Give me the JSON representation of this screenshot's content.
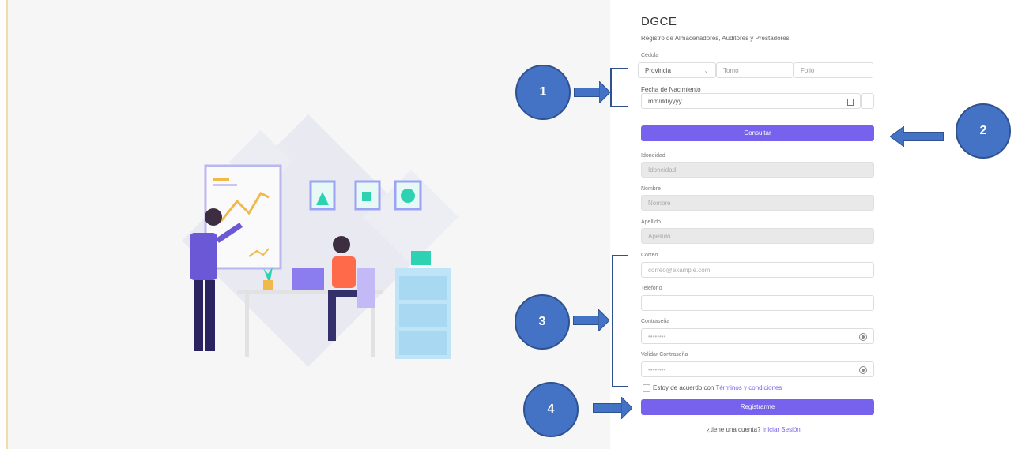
{
  "header": {
    "title": "DGCE",
    "subtitle": "Registro de Almacenadores, Auditores y Prestadores"
  },
  "cedula": {
    "label": "Cédula",
    "provincia": "Provincia",
    "tomo": "Tomo",
    "folio": "Folio"
  },
  "birth": {
    "label": "Fecha de Nacimiento",
    "placeholder": "mm/dd/yyyy"
  },
  "consult_button": "Consultar",
  "idoneidad": {
    "label": "Idoneidad",
    "placeholder": "Idoneidad"
  },
  "nombre": {
    "label": "Nombre",
    "placeholder": "Nombre"
  },
  "apellido": {
    "label": "Apellido",
    "placeholder": "Apellido"
  },
  "correo": {
    "label": "Correo",
    "placeholder": "correo@example.com"
  },
  "telefono": {
    "label": "Teléfono"
  },
  "password": {
    "label": "Contraseña",
    "mask": "••••••••"
  },
  "validate_password": {
    "label": "Validar Contraseña",
    "mask": "••••••••"
  },
  "terms": {
    "prefix": "Estoy de acuerdo con",
    "link": "Términos y condiciones"
  },
  "register_button": "Registrarme",
  "login": {
    "prompt": "¿tiene una cuenta?",
    "link": "Iniciar Sesión"
  },
  "annotations": [
    "1",
    "2",
    "3",
    "4"
  ],
  "colors": {
    "accent": "#7662ec",
    "callout": "#4472c4",
    "link": "#7662ec"
  }
}
